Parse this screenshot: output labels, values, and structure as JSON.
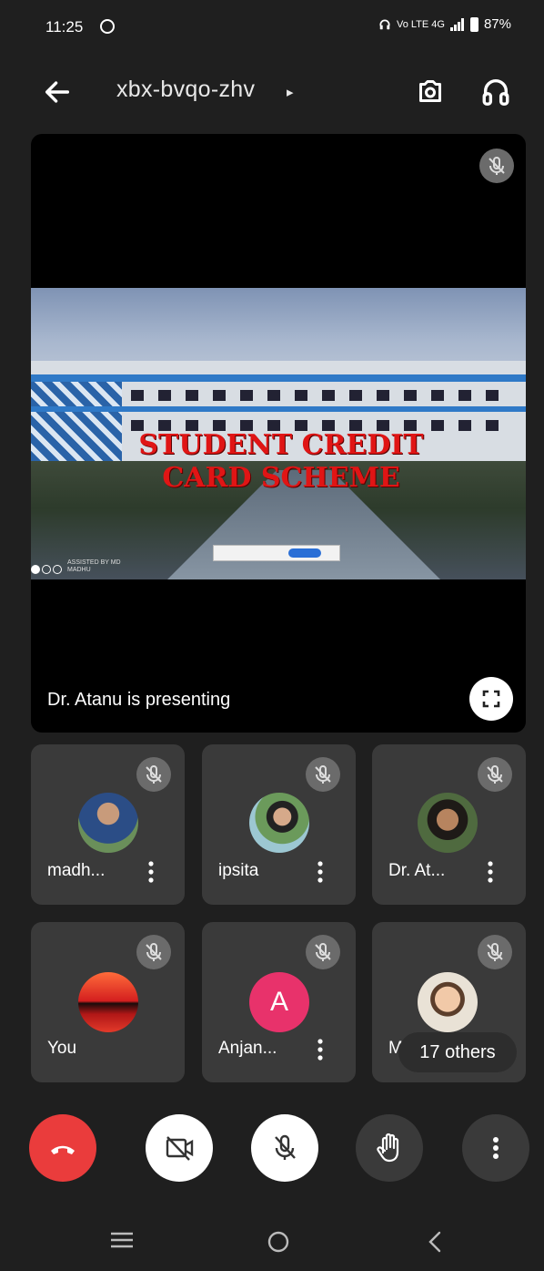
{
  "status_bar": {
    "time": "11:25",
    "network": "Vo LTE 4G",
    "battery": "87%"
  },
  "header": {
    "meeting_code": "xbx-bvqo-zhv",
    "caret": "▸"
  },
  "presentation": {
    "slide_title_line1": "STUDENT CREDIT",
    "slide_title_line2": "CARD SCHEME",
    "slide_small_text": "ASSISTED BY MD MADHU",
    "presenting_label": "Dr. Atanu is presenting"
  },
  "participants": [
    {
      "name": "madh...",
      "avatar": "photo",
      "muted": true
    },
    {
      "name": "ipsita",
      "avatar": "photo",
      "muted": true
    },
    {
      "name": "Dr. At...",
      "avatar": "photo",
      "muted": true
    },
    {
      "name": "You",
      "avatar": "photo",
      "muted": true
    },
    {
      "name": "Anjan...",
      "avatar": "letter",
      "avatar_letter": "A",
      "avatar_color": "#e8326b",
      "muted": true
    },
    {
      "name": "M",
      "avatar": "photo",
      "muted": true
    }
  ],
  "others_label": "17 others",
  "colors": {
    "end_call": "#ea3c3c",
    "tile_bg": "#3a3a3a",
    "background": "#1f1f1f"
  },
  "icons": {
    "back": "arrow-left-icon",
    "switch_camera": "switch-camera-icon",
    "audio": "headphones-icon",
    "mic_off": "mic-off-icon",
    "fullscreen": "fullscreen-icon",
    "more": "more-vert-icon",
    "end_call": "end-call-icon",
    "video_off": "video-off-icon",
    "raise_hand": "raise-hand-icon",
    "nav_recents": "nav-recents-icon",
    "nav_home": "nav-home-icon",
    "nav_back": "nav-back-icon"
  }
}
